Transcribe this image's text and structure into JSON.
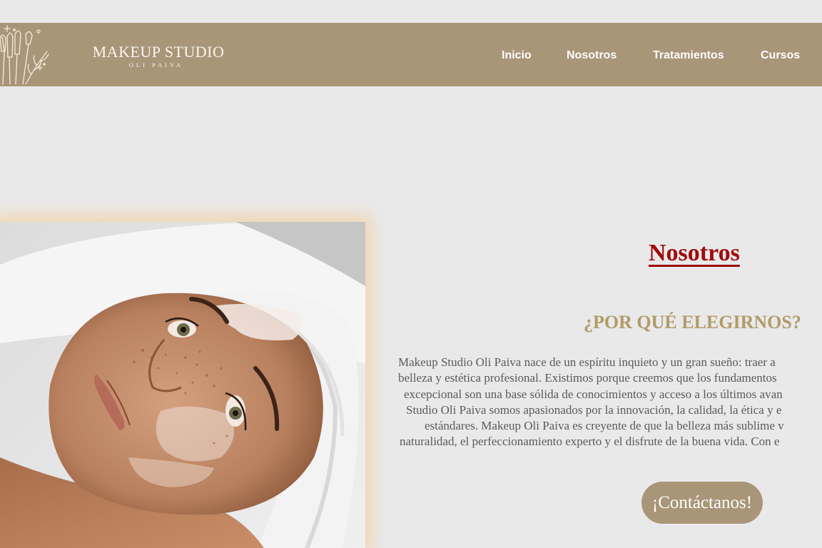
{
  "header": {
    "brand_title": "MAKEUP STUDIO",
    "brand_subtitle": "OLI PAIVA",
    "nav": [
      {
        "label": "Inicio"
      },
      {
        "label": "Nosotros"
      },
      {
        "label": "Tratamientos"
      },
      {
        "label": "Cursos"
      }
    ]
  },
  "about": {
    "title": "Nosotros",
    "subtitle": "¿POR QUÉ ELEGIRNOS?",
    "paragraph_lines": [
      "Makeup Studio Oli Paiva nace de un espíritu inquieto y un gran sueño: traer a",
      "belleza y estética profesional. Existimos porque creemos que los fundamentos",
      "excepcional son una base sólida de conocimientos y acceso a los últimos avan",
      "Studio Oli Paiva somos apasionados por la innovación, la calidad, la ética y e",
      "estándares. Makeup Oli Paiva es creyente de que la belleza más sublime v",
      "naturalidad, el perfeccionamiento experto y el disfrute de la buena vida. Con e"
    ],
    "cta_label": "¡Contáctanos!"
  },
  "colors": {
    "nav_background": "#a99578",
    "page_background": "#e9e9ea",
    "title_red": "#a00c0c",
    "subtitle_gold": "#b29b68",
    "body_text": "#5a5a5a"
  },
  "icons": {
    "logo": "makeup-brushes-icon"
  }
}
